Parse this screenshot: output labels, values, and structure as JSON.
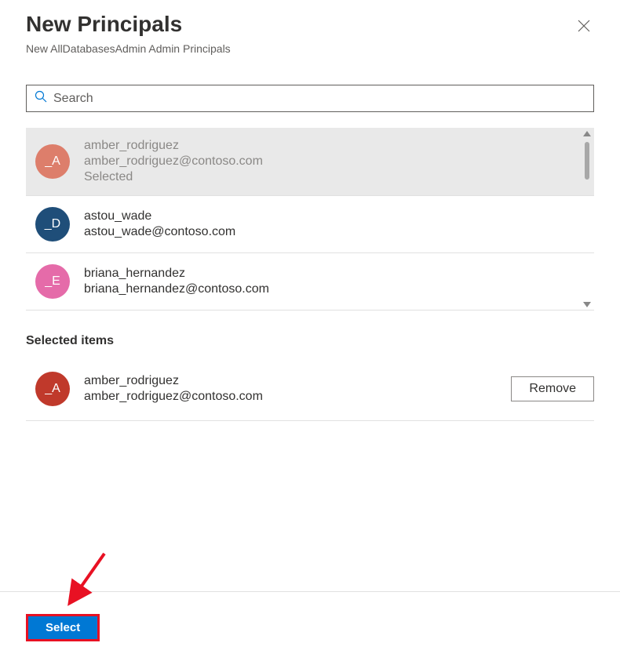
{
  "header": {
    "title": "New Principals",
    "subtitle": "New AllDatabasesAdmin Admin Principals"
  },
  "search": {
    "placeholder": "Search"
  },
  "results": [
    {
      "name": "amber_rodriguez",
      "email": "amber_rodriguez@contoso.com",
      "status": "Selected",
      "avatarText": "_A",
      "avatarColor": "#dd7e6b",
      "selected": true
    },
    {
      "name": "astou_wade",
      "email": "astou_wade@contoso.com",
      "avatarText": "_D",
      "avatarColor": "#1f4e79",
      "selected": false
    },
    {
      "name": "briana_hernandez",
      "email": "briana_hernandez@contoso.com",
      "avatarText": "_E",
      "avatarColor": "#e56ba9",
      "selected": false
    }
  ],
  "selectedSection": {
    "heading": "Selected items",
    "items": [
      {
        "name": "amber_rodriguez",
        "email": "amber_rodriguez@contoso.com",
        "avatarText": "_A",
        "avatarColor": "#c0392b"
      }
    ],
    "removeLabel": "Remove"
  },
  "footer": {
    "selectLabel": "Select"
  }
}
